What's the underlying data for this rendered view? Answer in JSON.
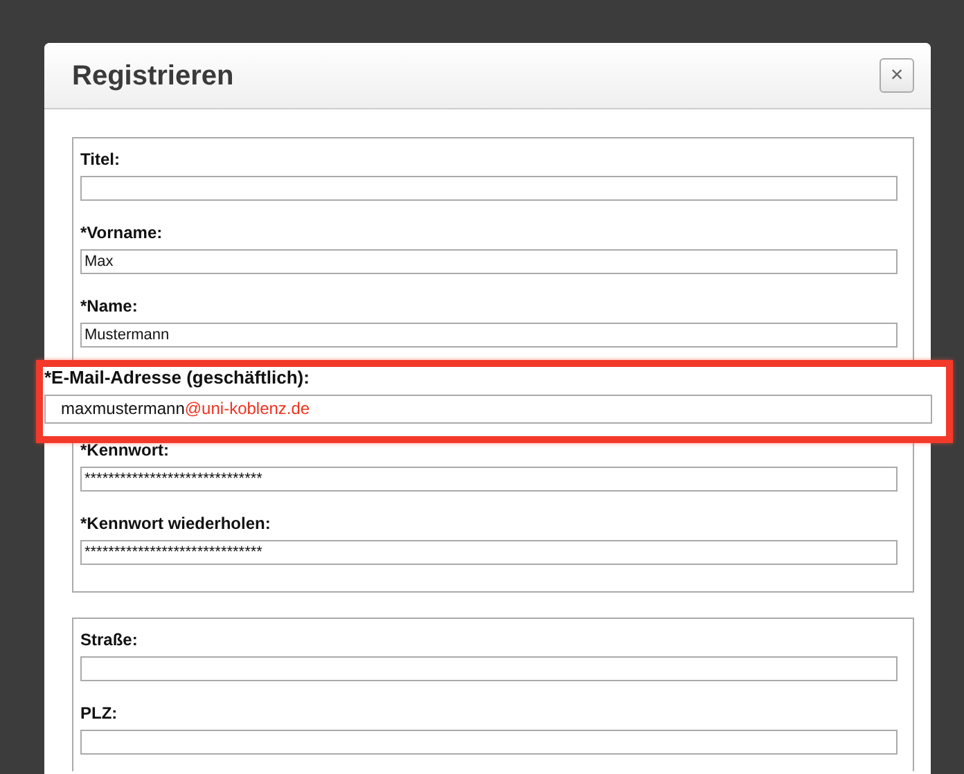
{
  "dialog": {
    "title": "Registrieren",
    "close_button": "×"
  },
  "fieldsets": [
    {
      "fields": [
        {
          "label": "Titel:",
          "highlighted": false
        },
        {
          "label": "*Vorname:",
          "value_parts": [
            {
              "text": "Max",
              "color": "#111111"
            }
          ],
          "highlighted": false
        },
        {
          "label": "*Name:",
          "value_parts": [
            {
              "text": "Mustermann",
              "color": "#111111"
            }
          ],
          "highlighted": false
        },
        {
          "label": "*E-Mail-Adresse (geschäftlich):",
          "value_parts": [
            {
              "text": "maxmustermann",
              "color": "#111111"
            },
            {
              "text": "@uni-koblenz.de",
              "color": "#f0321e"
            }
          ],
          "highlighted": true
        },
        {
          "label": "*Kennwort:",
          "value_parts": [
            {
              "text": "******************************",
              "color": "#111111"
            }
          ],
          "highlighted": false
        },
        {
          "label": "*Kennwort wiederholen:",
          "value_parts": [
            {
              "text": "******************************",
              "color": "#111111"
            }
          ],
          "highlighted": false
        }
      ]
    },
    {
      "fields": [
        {
          "label": "Straße:",
          "highlighted": false
        },
        {
          "label": "PLZ:",
          "highlighted": false
        }
      ]
    }
  ]
}
